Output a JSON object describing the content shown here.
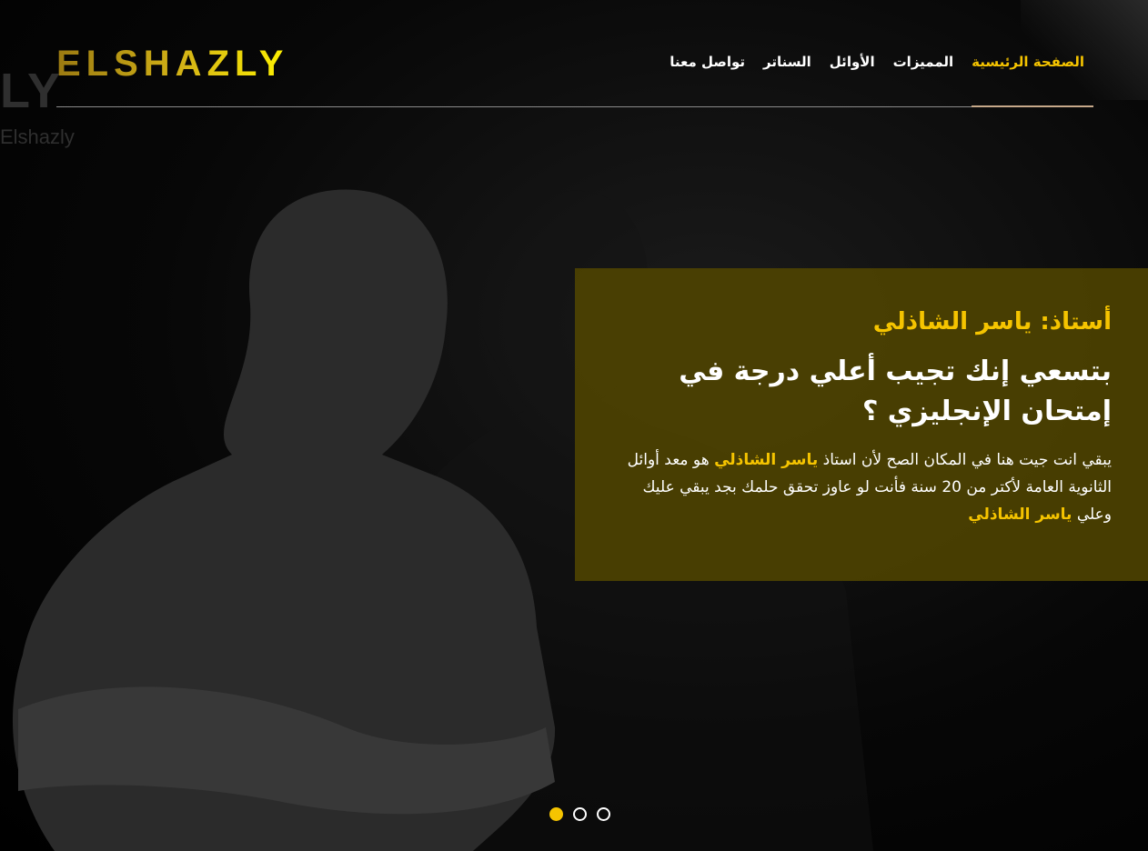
{
  "brand": {
    "logo_text": "ELSHAZLY",
    "bg_watermark_big": "LY",
    "bg_watermark_small": "Elshazly"
  },
  "nav": {
    "items": [
      {
        "label": "الصفحة الرئيسية",
        "active": true
      },
      {
        "label": "المميزات",
        "active": false
      },
      {
        "label": "الأوائل",
        "active": false
      },
      {
        "label": "السناتر",
        "active": false
      },
      {
        "label": "تواصل معنا",
        "active": false
      }
    ]
  },
  "hero": {
    "subtitle": "أستاذ: ياسر الشاذلي",
    "headline_line1": "بتسعي إنك تجيب أعلي درجة في",
    "headline_line2": "إمتحان الإنجليزي ؟",
    "desc_1": "يبقي انت جيت هنا في المكان الصح لأن استاذ ",
    "desc_name_1": "ياسر الشاذلي",
    "desc_2": " هو معد أوائل الثانوية العامة لأكتر من 20 سنة فأنت لو عاوز تحقق حلمك بجد يبقي عليك وعلي ",
    "desc_name_2": "ياسر الشاذلي"
  },
  "slider": {
    "count": 3,
    "active_index": 0
  },
  "colors": {
    "accent": "#f5c400",
    "panel": "#524600",
    "background": "#000000"
  }
}
